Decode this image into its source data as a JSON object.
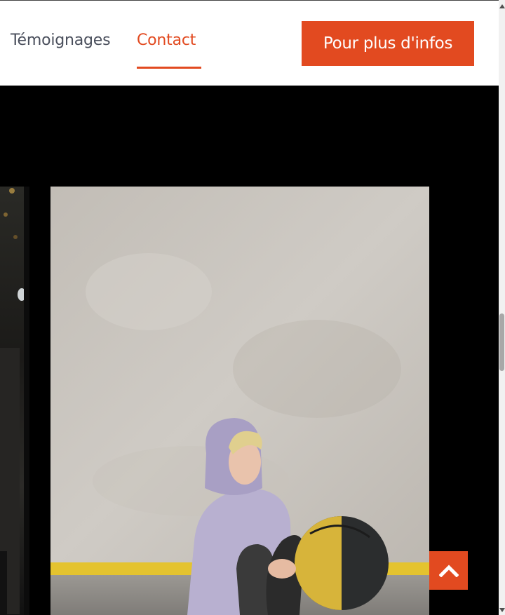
{
  "nav": {
    "links": [
      {
        "label": "Témoignages",
        "active": false
      },
      {
        "label": "Contact",
        "active": true
      }
    ],
    "cta_label": "Pour plus d'infos"
  },
  "colors": {
    "accent": "#e24a20",
    "nav_text": "#4a4f5c",
    "header_bg": "#ffffff",
    "section_bg": "#000000"
  },
  "carousel": {
    "main_photo_icon": "woman-hoodie-medicine-ball-photo",
    "previous_photo_icon": "gym-interior-photo"
  },
  "back_to_top_icon": "chevron-up-icon"
}
